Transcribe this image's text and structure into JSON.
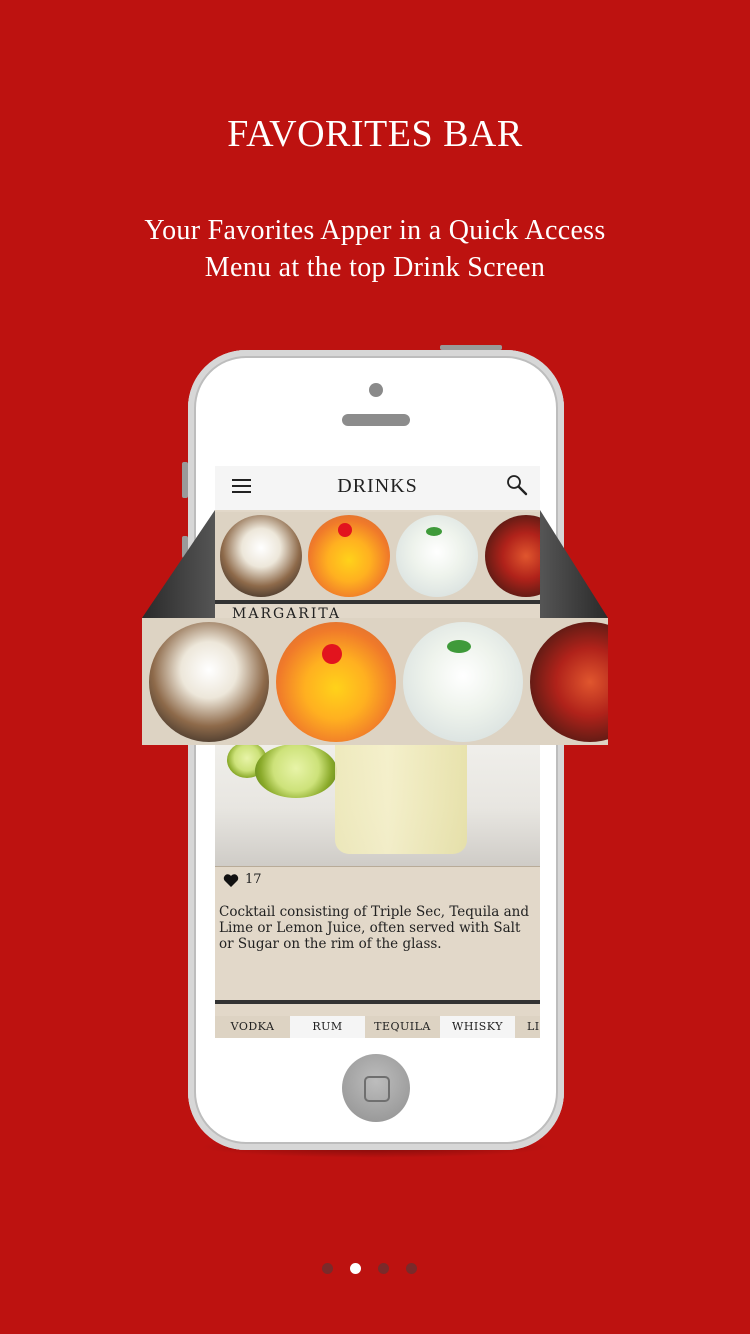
{
  "intro": {
    "title": "FAVORITES BAR",
    "subtitle_line1": "Your Favorites Apper in a Quick Access",
    "subtitle_line2": "Menu at the top Drink Screen"
  },
  "colors": {
    "background": "#bd1210",
    "strip": "#ddd3c3",
    "page_dot_active": "#ffffff",
    "page_dot_inactive": "#7a2a2a"
  },
  "app": {
    "title": "DRINKS",
    "menu_icon": "hamburger-menu-icon",
    "search_icon": "search-icon",
    "favorites": [
      {
        "icon": "white-russian-drink"
      },
      {
        "icon": "orange-cocktail-with-cherry"
      },
      {
        "icon": "mojito-drink"
      },
      {
        "icon": "red-negroni-drink"
      }
    ],
    "drink_name": "MARGARITA",
    "likes": "17",
    "description": "Cocktail consisting of Triple Sec, Tequila and Lime or Lemon Juice, often served with Salt or Sugar on the rim of the glass.",
    "tabs": [
      "VODKA",
      "RUM",
      "TEQUILA",
      "WHISKY",
      "LI"
    ]
  },
  "pager": {
    "count": 4,
    "active_index": 1
  }
}
